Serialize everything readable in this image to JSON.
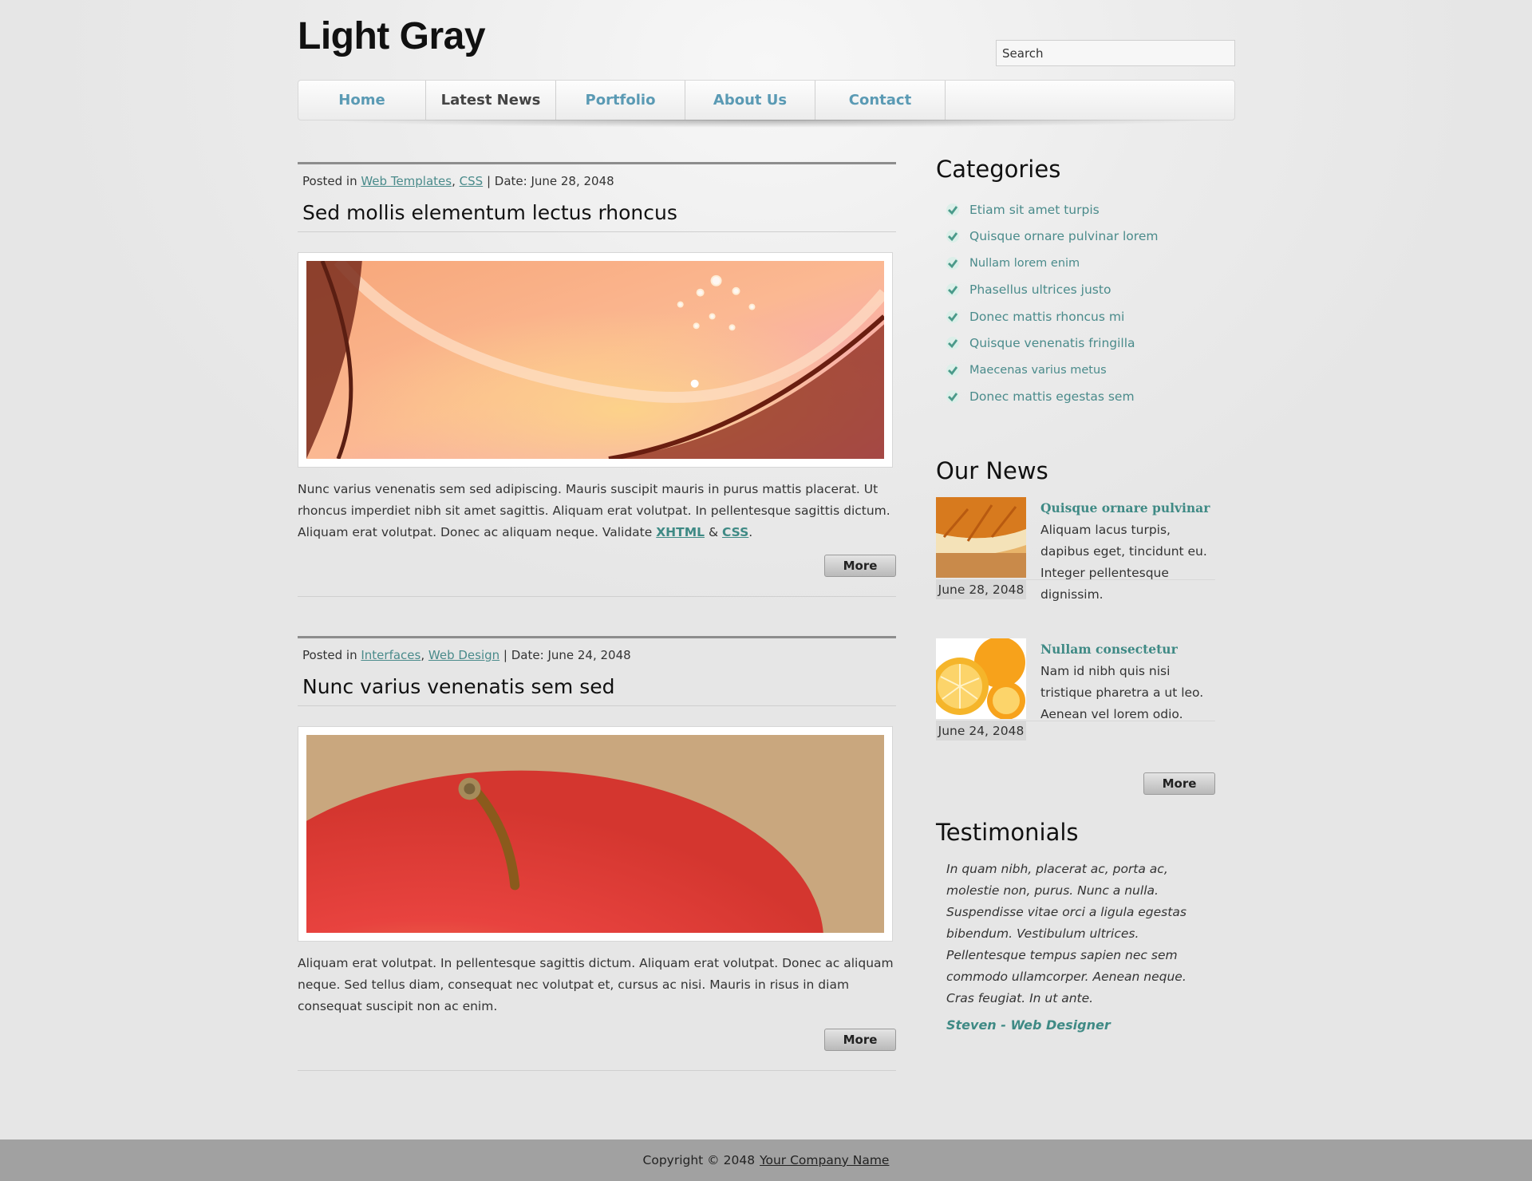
{
  "site": {
    "title": "Light Gray"
  },
  "search": {
    "placeholder": "Search"
  },
  "nav": {
    "items": [
      {
        "label": "Home"
      },
      {
        "label": "Latest News"
      },
      {
        "label": "Portfolio"
      },
      {
        "label": "About Us"
      },
      {
        "label": "Contact"
      }
    ],
    "active_index": 1
  },
  "posts": [
    {
      "posted_in_label": "Posted in",
      "categories": [
        "Web Templates",
        "CSS"
      ],
      "date_label": "Date:",
      "date": "June 28, 2048",
      "title": "Sed mollis elementum lectus rhoncus",
      "image": "staircase-chandelier-photo",
      "body": "Nunc varius venenatis sem sed adipiscing. Mauris suscipit mauris in purus mattis placerat. Ut rhoncus imperdiet nibh sit amet sagittis. Aliquam erat volutpat. In pellentesque sagittis dictum. Aliquam erat volutpat. Donec ac aliquam neque. Validate",
      "link1": "XHTML",
      "amp": "&",
      "link2": "CSS",
      "end": ".",
      "more_label": "More"
    },
    {
      "posted_in_label": "Posted in",
      "categories": [
        "Interfaces",
        "Web Design"
      ],
      "date_label": "Date:",
      "date": "June 24, 2048",
      "title": "Nunc varius venenatis sem sed",
      "image": "red-apple-photo",
      "body": "Aliquam erat volutpat. In pellentesque sagittis dictum. Aliquam erat volutpat. Donec ac aliquam neque. Sed tellus diam, consequat nec volutpat et, cursus ac nisi. Mauris in risus in diam consequat suscipit non ac enim.",
      "more_label": "More"
    }
  ],
  "sidebar": {
    "categories_title": "Categories",
    "categories": [
      "Etiam sit amet turpis",
      "Quisque ornare pulvinar lorem",
      "Nullam lorem enim",
      "Phasellus ultrices justo",
      "Donec mattis rhoncus mi",
      "Quisque venenatis fringilla",
      "Maecenas varius metus",
      "Donec mattis egestas sem"
    ],
    "news_title": "Our News",
    "news": [
      {
        "title": "Quisque ornare pulvinar",
        "text": "Aliquam lacus turpis, dapibus eget, tincidunt eu. Integer pellentesque dignissim.",
        "date": "June 28, 2048",
        "image": "orange-slice-photo"
      },
      {
        "title": "Nullam consectetur",
        "text": "Nam id nibh quis nisi tristique pharetra a ut leo. Aenean vel lorem odio.",
        "date": "June 24, 2048",
        "image": "oranges-photo"
      }
    ],
    "news_more_label": "More",
    "testimonials_title": "Testimonials",
    "testimonial_text": "In quam nibh, placerat ac, porta ac, molestie non, purus. Nunc a nulla. Suspendisse vitae orci a ligula egestas bibendum. Vestibulum ultrices. Pellentesque tempus sapien nec sem commodo ullamcorper. Aenean neque. Cras feugiat. In ut ante.",
    "testimonial_author": "Steven - Web Designer"
  },
  "footer": {
    "copyright": "Copyright © 2048",
    "company_link": "Your Company Name"
  },
  "colors": {
    "accent_link": "#4a8b8b",
    "nav_link": "#5a9ab4",
    "footer_bg": "#a1a1a1"
  }
}
